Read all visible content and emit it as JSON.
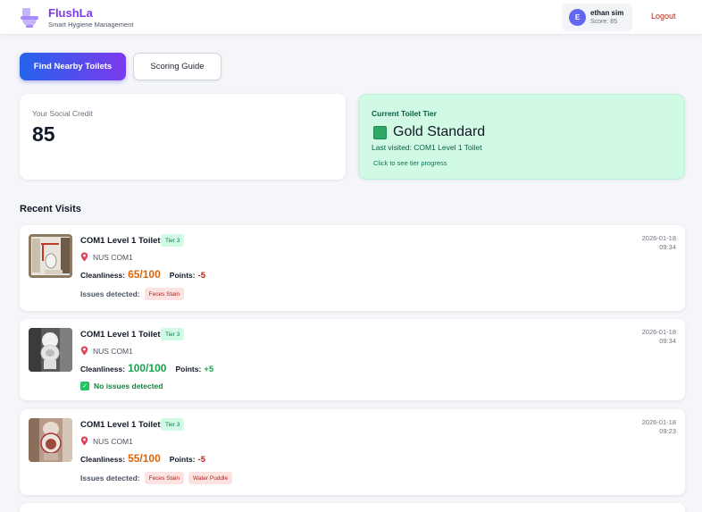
{
  "header": {
    "app_name": "FlushLa",
    "tagline": "Smart Hygiene Management",
    "user": {
      "initial": "E",
      "name": "ethan sim",
      "score": "Score: 85"
    },
    "logout_label": "Logout"
  },
  "actions": {
    "find_label": "Find Nearby Toilets",
    "scoring_label": "Scoring Guide"
  },
  "credit": {
    "label": "Your Social Credit",
    "value": "85"
  },
  "tier": {
    "label": "Current Toilet Tier",
    "name": "Gold Standard",
    "last_visited": "Last visited: COM1 Level 1 Toilet",
    "progress_link": "Click to see tier progress",
    "color": "#2fa866"
  },
  "recent_title": "Recent Visits",
  "visits": [
    {
      "title": "COM1 Level 1 Toilet",
      "tier": "Tier 3",
      "location": "NUS COM1",
      "cleanliness_label": "Cleanliness:",
      "cleanliness": "65/100",
      "points_label": "Points:",
      "points": "-5",
      "issues_label": "Issues detected:",
      "issues": [
        "Feces Stain"
      ],
      "date": "2026-01-18",
      "time": "09:34"
    },
    {
      "title": "COM1 Level 1 Toilet",
      "tier": "Tier 3",
      "location": "NUS COM1",
      "cleanliness_label": "Cleanliness:",
      "cleanliness": "100/100",
      "points_label": "Points:",
      "points": "+5",
      "no_issues_label": "No issues detected",
      "date": "2026-01-18",
      "time": "09:34"
    },
    {
      "title": "COM1 Level 1 Toilet",
      "tier": "Tier 3",
      "location": "NUS COM1",
      "cleanliness_label": "Cleanliness:",
      "cleanliness": "55/100",
      "points_label": "Points:",
      "points": "-5",
      "issues_label": "Issues detected:",
      "issues": [
        "Feces Stain",
        "Water Puddle"
      ],
      "date": "2026-01-18",
      "time": "09:23"
    }
  ],
  "colors": {
    "brand": "#7c3aed",
    "primary_gradient_start": "#2563eb",
    "primary_gradient_end": "#7c3aed",
    "bad_score": "#d9650b",
    "good_score": "#16a34a",
    "issue_tag_bg": "#fde2e2"
  }
}
